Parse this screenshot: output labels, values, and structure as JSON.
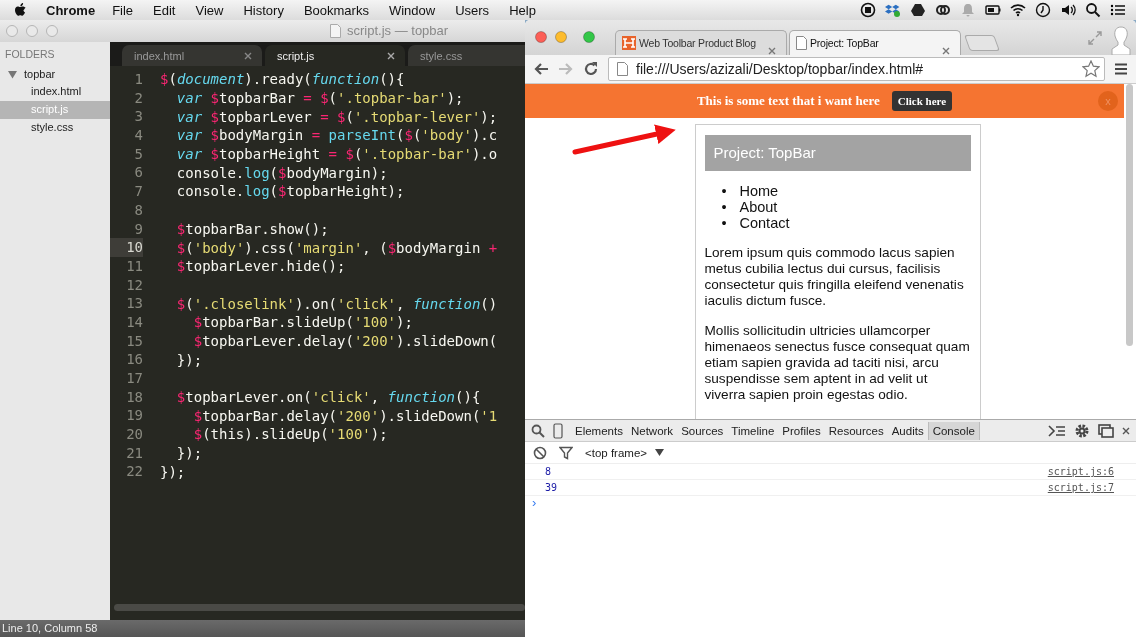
{
  "menu_bar": {
    "app": "Chrome",
    "items": [
      "File",
      "Edit",
      "View",
      "History",
      "Bookmarks",
      "Window",
      "Users",
      "Help"
    ]
  },
  "editor": {
    "title": "script.js — topbar",
    "sidebar": {
      "heading": "FOLDERS",
      "folder": {
        "name": "topbar",
        "expanded": true,
        "children": [
          {
            "name": "index.html",
            "selected": false
          },
          {
            "name": "script.js",
            "selected": true
          },
          {
            "name": "style.css",
            "selected": false
          }
        ]
      }
    },
    "tabs": [
      {
        "label": "index.html",
        "selected": false,
        "close_button": true
      },
      {
        "label": "script.js",
        "selected": true,
        "close_button": true
      },
      {
        "label": "style.css",
        "selected": false,
        "close_button": false
      }
    ],
    "lines": [
      {
        "number": "1",
        "current": false,
        "tokens": [
          {
            "kind": "dollar",
            "text": "$"
          },
          {
            "kind": "plain",
            "text": "("
          },
          {
            "kind": "keyword",
            "text": "document"
          },
          {
            "kind": "plain",
            "text": ").ready("
          },
          {
            "kind": "keyword",
            "text": "function"
          },
          {
            "kind": "plain",
            "text": "(){"
          }
        ]
      },
      {
        "number": "2",
        "current": false,
        "tokens": [
          {
            "kind": "keyword",
            "text": "  var "
          },
          {
            "kind": "dollar",
            "text": "$"
          },
          {
            "kind": "plain",
            "text": "topbarBar"
          },
          {
            "kind": "operator",
            "text": " = "
          },
          {
            "kind": "dollar",
            "text": "$"
          },
          {
            "kind": "plain",
            "text": "("
          },
          {
            "kind": "string",
            "text": "'.topbar-bar'"
          },
          {
            "kind": "plain",
            "text": ");"
          }
        ]
      },
      {
        "number": "3",
        "current": false,
        "tokens": [
          {
            "kind": "keyword",
            "text": "  var "
          },
          {
            "kind": "dollar",
            "text": "$"
          },
          {
            "kind": "plain",
            "text": "topbarLever"
          },
          {
            "kind": "operator",
            "text": " = "
          },
          {
            "kind": "dollar",
            "text": "$"
          },
          {
            "kind": "plain",
            "text": "("
          },
          {
            "kind": "string",
            "text": "'.topbar-lever'"
          },
          {
            "kind": "plain",
            "text": ");"
          }
        ]
      },
      {
        "number": "4",
        "current": false,
        "tokens": [
          {
            "kind": "keyword",
            "text": "  var "
          },
          {
            "kind": "dollar",
            "text": "$"
          },
          {
            "kind": "plain",
            "text": "bodyMargin"
          },
          {
            "kind": "operator",
            "text": " = "
          },
          {
            "kind": "call",
            "text": "parseInt"
          },
          {
            "kind": "plain",
            "text": "("
          },
          {
            "kind": "dollar",
            "text": "$"
          },
          {
            "kind": "plain",
            "text": "("
          },
          {
            "kind": "string",
            "text": "'body'"
          },
          {
            "kind": "plain",
            "text": ").c"
          }
        ]
      },
      {
        "number": "5",
        "current": false,
        "tokens": [
          {
            "kind": "keyword",
            "text": "  var "
          },
          {
            "kind": "dollar",
            "text": "$"
          },
          {
            "kind": "plain",
            "text": "topbarHeight"
          },
          {
            "kind": "operator",
            "text": " = "
          },
          {
            "kind": "dollar",
            "text": "$"
          },
          {
            "kind": "plain",
            "text": "("
          },
          {
            "kind": "string",
            "text": "'.topbar-bar'"
          },
          {
            "kind": "plain",
            "text": ").o"
          }
        ]
      },
      {
        "number": "6",
        "current": false,
        "tokens": [
          {
            "kind": "plain",
            "text": "  console."
          },
          {
            "kind": "call",
            "text": "log"
          },
          {
            "kind": "plain",
            "text": "("
          },
          {
            "kind": "dollar",
            "text": "$"
          },
          {
            "kind": "plain",
            "text": "bodyMargin);"
          }
        ]
      },
      {
        "number": "7",
        "current": false,
        "tokens": [
          {
            "kind": "plain",
            "text": "  console."
          },
          {
            "kind": "call",
            "text": "log"
          },
          {
            "kind": "plain",
            "text": "("
          },
          {
            "kind": "dollar",
            "text": "$"
          },
          {
            "kind": "plain",
            "text": "topbarHeight);"
          }
        ]
      },
      {
        "number": "8",
        "current": false
      },
      {
        "number": "9",
        "current": false,
        "tokens": [
          {
            "kind": "dollar",
            "text": "  $"
          },
          {
            "kind": "plain",
            "text": "topbarBar.show();"
          }
        ]
      },
      {
        "number": "10",
        "current": true,
        "tokens": [
          {
            "kind": "dollar",
            "text": "  $"
          },
          {
            "kind": "plain",
            "text": "("
          },
          {
            "kind": "string",
            "text": "'body'"
          },
          {
            "kind": "plain",
            "text": ").css("
          },
          {
            "kind": "string",
            "text": "'margin'"
          },
          {
            "kind": "plain",
            "text": ", ("
          },
          {
            "kind": "dollar",
            "text": "$"
          },
          {
            "kind": "plain",
            "text": "bodyMargin "
          },
          {
            "kind": "operator",
            "text": "+"
          }
        ]
      },
      {
        "number": "11",
        "current": false,
        "tokens": [
          {
            "kind": "dollar",
            "text": "  $"
          },
          {
            "kind": "plain",
            "text": "topbarLever.hide();"
          }
        ]
      },
      {
        "number": "12",
        "current": false
      },
      {
        "number": "13",
        "current": false,
        "tokens": [
          {
            "kind": "dollar",
            "text": "  $"
          },
          {
            "kind": "plain",
            "text": "("
          },
          {
            "kind": "string",
            "text": "'.closelink'"
          },
          {
            "kind": "plain",
            "text": ").on("
          },
          {
            "kind": "string",
            "text": "'click'"
          },
          {
            "kind": "plain",
            "text": ", "
          },
          {
            "kind": "keyword",
            "text": "function"
          },
          {
            "kind": "plain",
            "text": "()"
          }
        ]
      },
      {
        "number": "14",
        "current": false,
        "tokens": [
          {
            "kind": "dollar",
            "text": "    $"
          },
          {
            "kind": "plain",
            "text": "topbarBar.slideUp("
          },
          {
            "kind": "string",
            "text": "'100'"
          },
          {
            "kind": "plain",
            "text": ");"
          }
        ]
      },
      {
        "number": "15",
        "current": false,
        "tokens": [
          {
            "kind": "dollar",
            "text": "    $"
          },
          {
            "kind": "plain",
            "text": "topbarLever.delay("
          },
          {
            "kind": "string",
            "text": "'200'"
          },
          {
            "kind": "plain",
            "text": ").slideDown("
          }
        ]
      },
      {
        "number": "16",
        "current": false,
        "tokens": [
          {
            "kind": "plain",
            "text": "  });"
          }
        ]
      },
      {
        "number": "17",
        "current": false
      },
      {
        "number": "18",
        "current": false,
        "tokens": [
          {
            "kind": "dollar",
            "text": "  $"
          },
          {
            "kind": "plain",
            "text": "topbarLever.on("
          },
          {
            "kind": "string",
            "text": "'click'"
          },
          {
            "kind": "plain",
            "text": ", "
          },
          {
            "kind": "keyword",
            "text": "function"
          },
          {
            "kind": "plain",
            "text": "(){"
          }
        ]
      },
      {
        "number": "19",
        "current": false,
        "tokens": [
          {
            "kind": "dollar",
            "text": "    $"
          },
          {
            "kind": "plain",
            "text": "topbarBar.delay("
          },
          {
            "kind": "string",
            "text": "'200'"
          },
          {
            "kind": "plain",
            "text": ").slideDown("
          },
          {
            "kind": "string",
            "text": "'1"
          }
        ]
      },
      {
        "number": "20",
        "current": false,
        "tokens": [
          {
            "kind": "dollar",
            "text": "    $"
          },
          {
            "kind": "plain",
            "text": "(this).slideUp("
          },
          {
            "kind": "string",
            "text": "'100'"
          },
          {
            "kind": "plain",
            "text": ");"
          }
        ]
      },
      {
        "number": "21",
        "current": false,
        "tokens": [
          {
            "kind": "plain",
            "text": "  });"
          }
        ]
      },
      {
        "number": "22",
        "current": false,
        "tokens": [
          {
            "kind": "plain",
            "text": "});"
          }
        ]
      }
    ],
    "status_bar": "Line 10, Column 58"
  },
  "browser": {
    "tabs": [
      {
        "title": "Web Toolbar Product Blog",
        "selected": false
      },
      {
        "title": "Project: TopBar",
        "selected": true
      }
    ],
    "url": "file:///Users/azizali/Desktop/topbar/index.html#",
    "forward_disabled": true,
    "page": {
      "topbar": {
        "text": "This is some text that i want here",
        "button": "Click here",
        "close": "x"
      },
      "heading": "Project: TopBar",
      "nav": {
        "marker": "•",
        "items": [
          "Home",
          "About",
          "Contact"
        ]
      },
      "paragraphs": [
        "Lorem ipsum quis commodo lacus sapien metus cubilia lectus dui cursus, facilisis consectetur quis fringilla eleifend venenatis iaculis dictum fusce.",
        "Mollis sollicitudin ultricies ullamcorper himenaeos senectus fusce consequat quam etiam sapien gravida ad taciti nisi, arcu suspendisse sem aptent in ad velit ut viverra sapien proin egestas odio."
      ]
    },
    "devtools": {
      "tabs": [
        {
          "label": "Elements",
          "selected": false
        },
        {
          "label": "Network",
          "selected": false
        },
        {
          "label": "Sources",
          "selected": false
        },
        {
          "label": "Timeline",
          "selected": false
        },
        {
          "label": "Profiles",
          "selected": false
        },
        {
          "label": "Resources",
          "selected": false
        },
        {
          "label": "Audits",
          "selected": false
        },
        {
          "label": "Console",
          "selected": true
        }
      ],
      "frame": "<top frame>",
      "messages": [
        {
          "value": "8",
          "source": "script.js:6"
        },
        {
          "value": "39",
          "source": "script.js:7"
        }
      ],
      "prompt": "›"
    }
  }
}
